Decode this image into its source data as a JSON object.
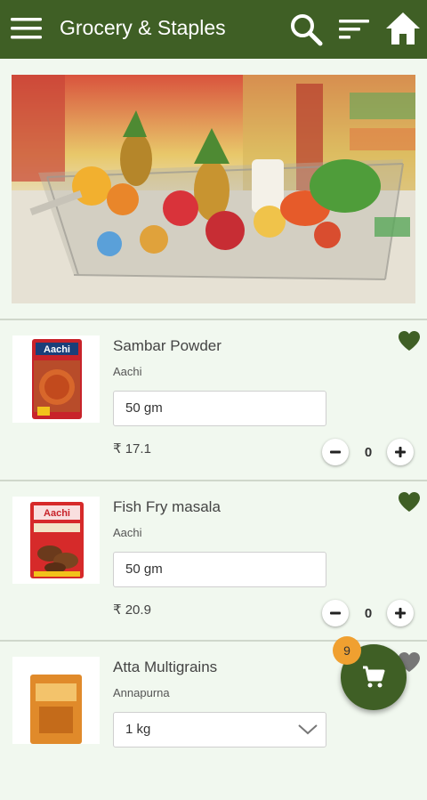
{
  "app_bar": {
    "title": "Grocery & Staples",
    "menu_icon": "menu-icon",
    "search_icon": "search-icon",
    "sort_icon": "sort-icon",
    "home_icon": "home-icon"
  },
  "colors": {
    "primary": "#3f5f25",
    "background": "#f1f8ef",
    "badge": "#f0a030"
  },
  "products": [
    {
      "name": "Sambar Powder",
      "brand": "Aachi",
      "packet_label": "Aachi",
      "quantity_option": "50 gm",
      "price": "₹ 17.1",
      "count": "0",
      "favorite": true
    },
    {
      "name": "Fish Fry masala",
      "brand": "Aachi",
      "packet_label": "Aachi",
      "quantity_option": "50 gm",
      "price": "₹ 20.9",
      "count": "0",
      "favorite": true
    },
    {
      "name": "Atta Multigrains",
      "brand": "Annapurna",
      "quantity_option": "1 kg",
      "favorite": false
    }
  ],
  "cart": {
    "icon": "cart-icon",
    "badge_count": "9"
  }
}
